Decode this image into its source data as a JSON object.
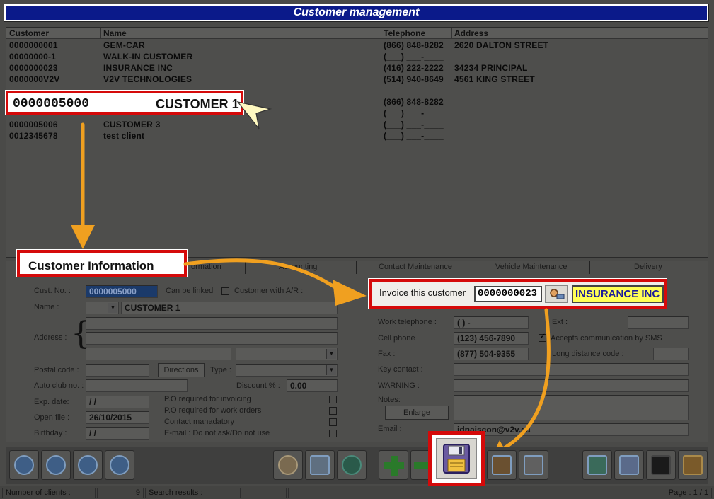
{
  "window": {
    "title": "Customer management"
  },
  "grid": {
    "headers": [
      "Customer",
      "Name",
      "Telephone",
      "Address"
    ],
    "rows": [
      [
        "0000000001",
        "GEM-CAR",
        "(866) 848-8282",
        "2620 DALTON STREET"
      ],
      [
        "00000000-1",
        "WALK-IN CUSTOMER",
        "(___) ___-____",
        ""
      ],
      [
        "0000000023",
        "INSURANCE INC",
        "(416) 222-2222",
        "34234 PRINCIPAL"
      ],
      [
        "0000000V2V",
        "V2V TECHNOLOGIES",
        "(514) 940-8649",
        "4561 KING STREET"
      ],
      [
        "",
        "",
        "(866) 848-8282",
        ""
      ],
      [
        "",
        "",
        "(___) ___-____",
        ""
      ],
      [
        "0000005006",
        "CUSTOMER 3",
        "(___) ___-____",
        ""
      ],
      [
        "0012345678",
        "test client",
        "(___) ___-____",
        ""
      ]
    ],
    "selected": {
      "code": "0000005000",
      "name": "CUSTOMER 1"
    }
  },
  "tabs": [
    "Customer Information",
    "Accounting",
    "Contact Maintenance",
    "Vehicle Maintenance",
    "Delivery"
  ],
  "tab_partial": "ormation",
  "form": {
    "cust_no_label": "Cust. No. :",
    "cust_no": "0000005000",
    "can_be_linked": "Can be linked",
    "customer_ar": "Customer with A/R :",
    "name_label": "Name :",
    "name": "CUSTOMER 1",
    "address_label": "Address :",
    "postal_label": "Postal code :",
    "postal_value": "___ ___",
    "directions": "Directions",
    "type_label": "Type :",
    "auto_club_label": "Auto club no. :",
    "discount_label": "Discount % :",
    "discount": "0.00",
    "exp_label": "Exp. date:",
    "exp": "/ /",
    "open_label": "Open file :",
    "open": "26/10/2015",
    "birthday_label": "Birthday :",
    "birthday": "/ /",
    "po_invoicing": "P.O required for invoicing",
    "po_work": "P.O required for work orders",
    "contact_mandatory": "Contact manadatory",
    "email_dont_ask": "E-mail : Do not ask/Do not use",
    "invoice_label": "Invoice this customer",
    "invoice_code": "0000000023",
    "invoice_name": "INSURANCE INC",
    "work_tel_label": "Work telephone :",
    "work_tel": "(   )     -",
    "ext_label": "Ext :",
    "cell_label": "Cell phone",
    "cell": "(123) 456-7890",
    "sms_label": "Accepts communication by SMS",
    "fax_label": "Fax :",
    "fax": "(877) 504-9355",
    "ld_label": "Long distance code :",
    "key_contact_label": "Key contact :",
    "warning_label": "WARNING :",
    "notes_label": "Notes:",
    "enlarge": "Enlarge",
    "email_label": "Email :",
    "email": "jdnaiscon@v2v.ca"
  },
  "status": {
    "clients_label": "Number of clients :",
    "clients": "9",
    "search_label": "Search results :",
    "page_label": "Page : 1 / 1"
  },
  "colors": {
    "title_bg": "#0b1a8a",
    "callout_border": "#d50a0a",
    "arrow": "#f0a020",
    "invoice_name_bg": "#ffff55"
  }
}
